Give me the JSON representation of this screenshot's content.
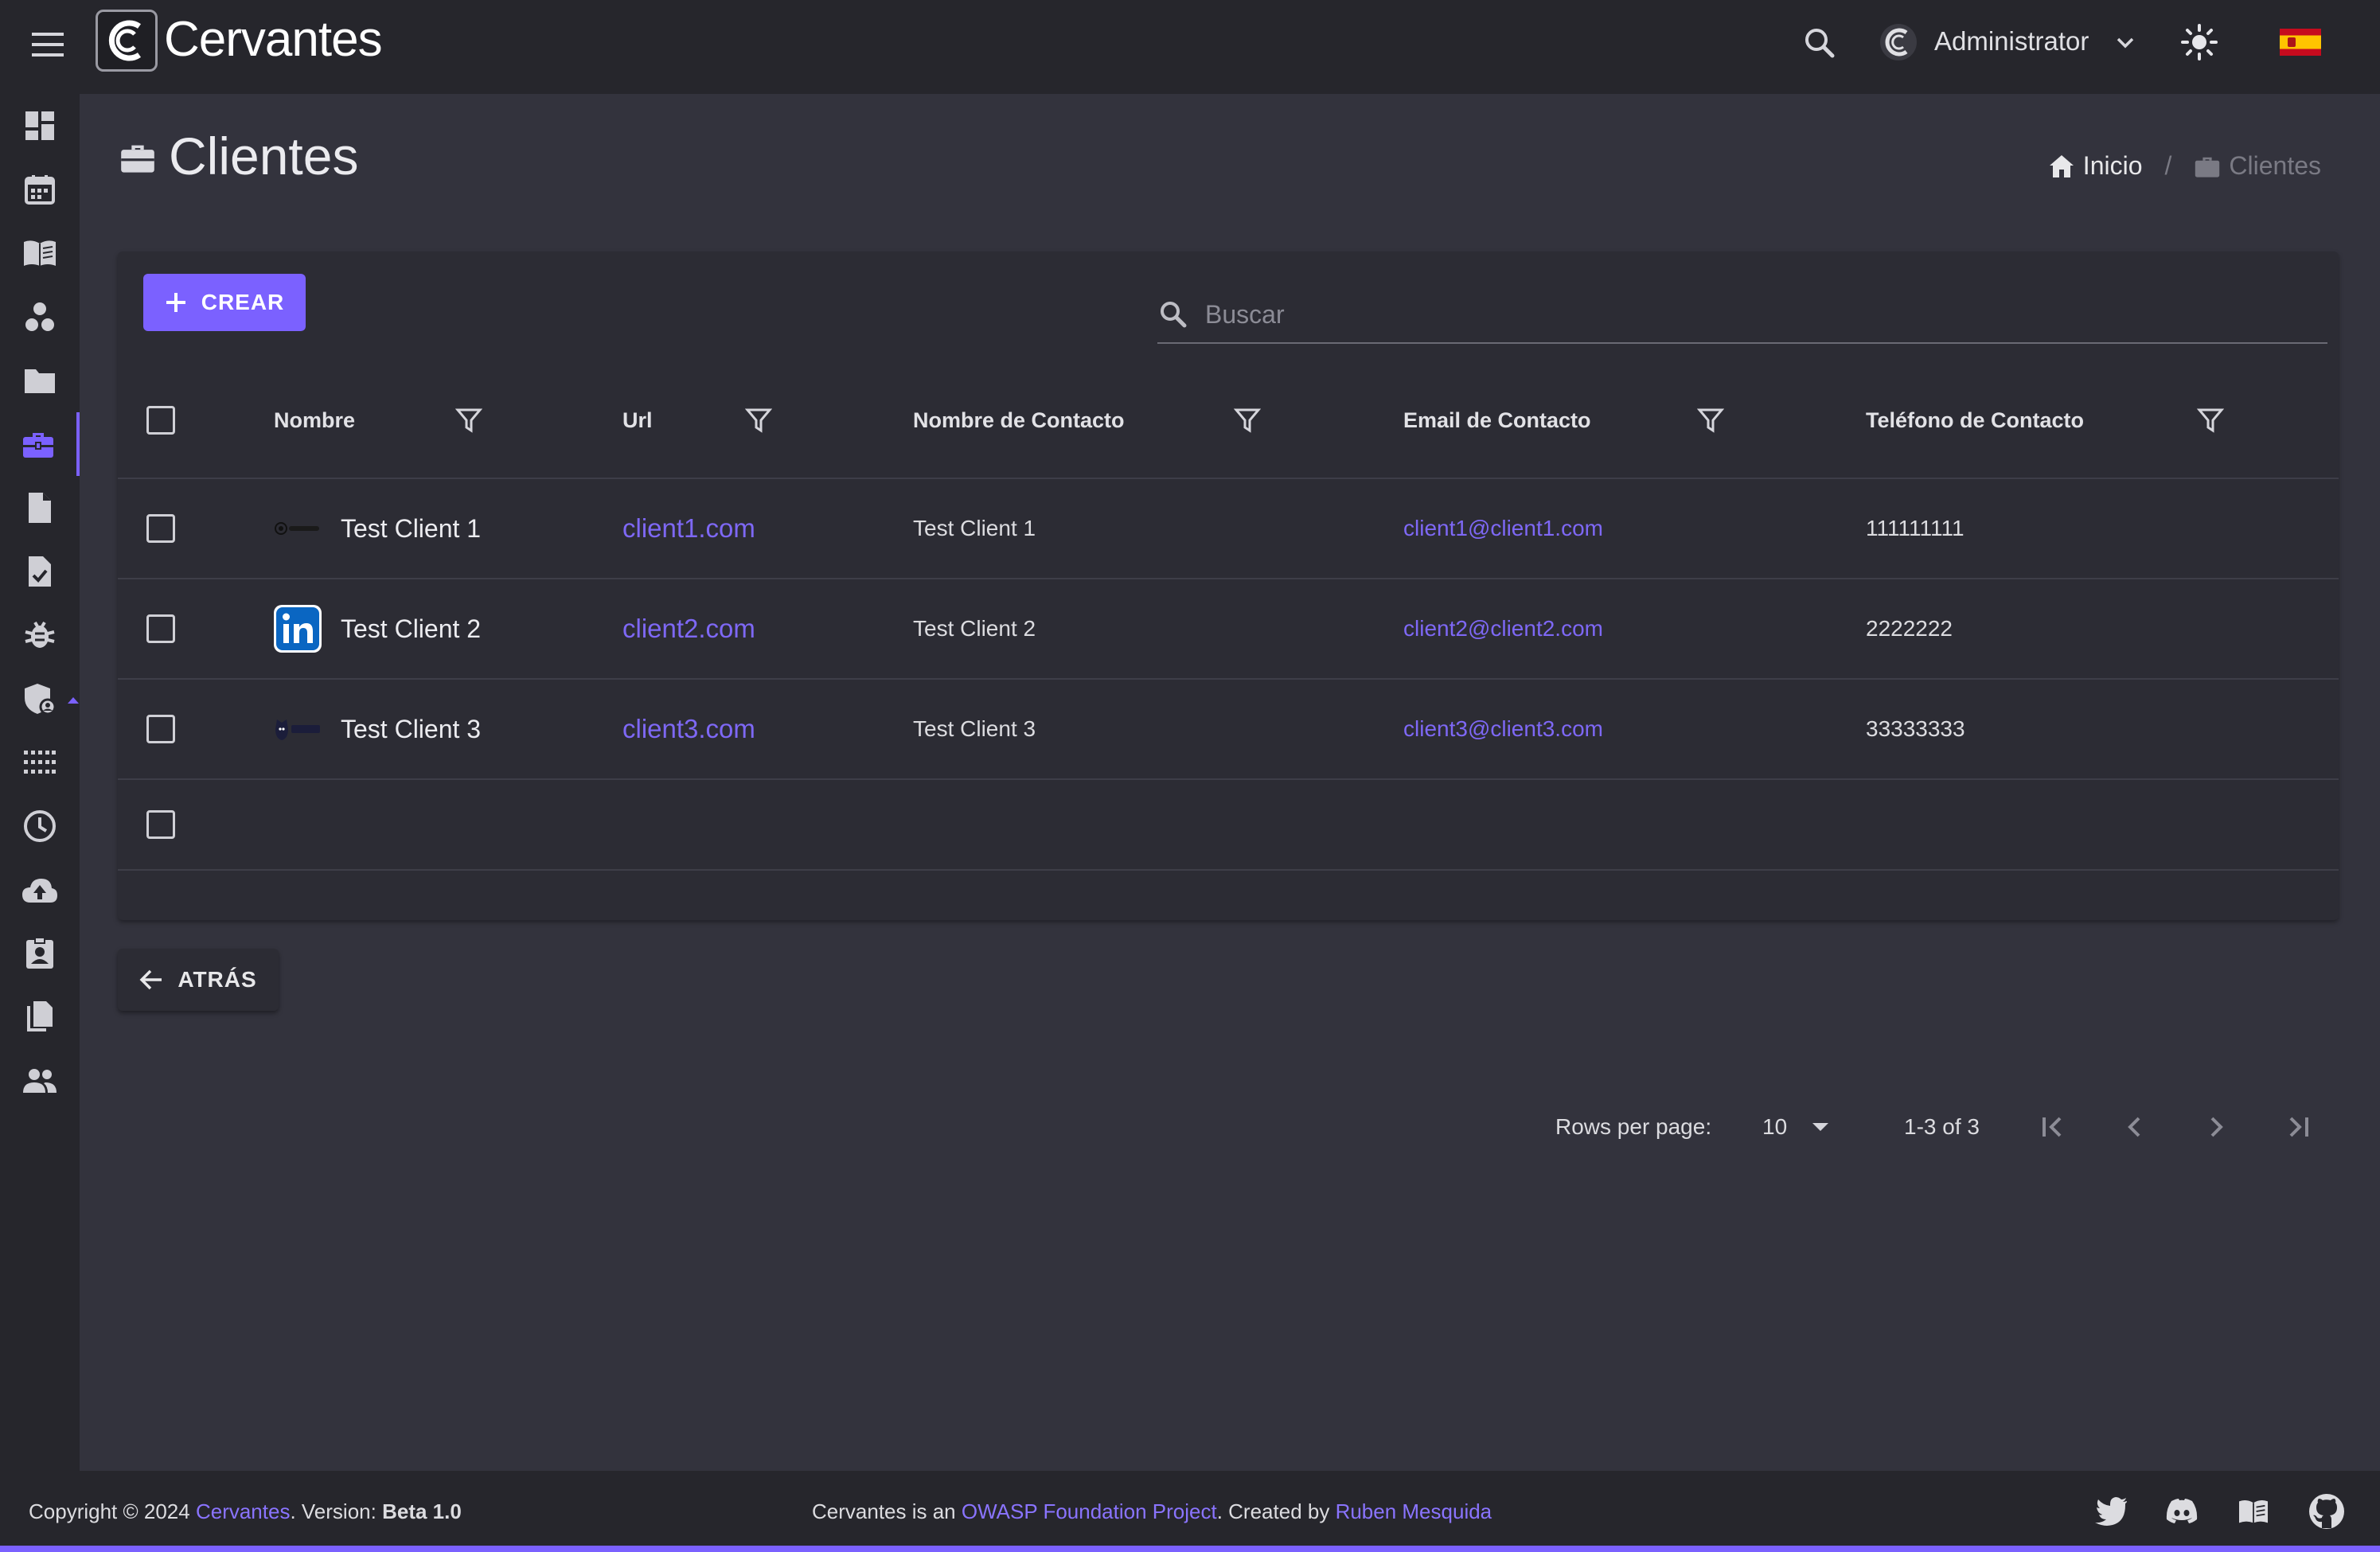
{
  "app": {
    "brand": "Cervantes",
    "user_name": "Administrator"
  },
  "page": {
    "title": "Clientes",
    "breadcrumb": {
      "home": "Inicio",
      "current": "Clientes"
    }
  },
  "toolbar": {
    "create_label": "CREAR",
    "search_placeholder": "Buscar",
    "back_label": "ATRÁS"
  },
  "table": {
    "columns": [
      "Nombre",
      "Url",
      "Nombre de Contacto",
      "Email de Contacto",
      "Teléfono de Contacto"
    ],
    "rows": [
      {
        "name": "Test Client 1",
        "url": "client1.com",
        "contact": "Test Client 1",
        "email": "client1@client1.com",
        "phone": "111111111",
        "logo": "qualys-logo"
      },
      {
        "name": "Test Client 2",
        "url": "client2.com",
        "contact": "Test Client 2",
        "email": "client2@client2.com",
        "phone": "2222222",
        "logo": "linkedin-logo"
      },
      {
        "name": "Test Client 3",
        "url": "client3.com",
        "contact": "Test Client 3",
        "email": "client3@client3.com",
        "phone": "33333333",
        "logo": "snyk-logo"
      }
    ]
  },
  "pagination": {
    "rows_per_page_label": "Rows per page:",
    "rows_per_page": "10",
    "range": "1-3 of 3"
  },
  "footer": {
    "copyright_prefix": "Copyright © 2024 ",
    "brand_link": "Cervantes",
    "version_prefix": ". Version: ",
    "version": "Beta 1.0",
    "owasp_prefix": "Cervantes is an ",
    "owasp_link": "OWASP Foundation Project",
    "created_prefix": ". Created by ",
    "author_link": "Ruben Mesquida"
  },
  "theme": {
    "accent": "#7b61ff",
    "background": "#33333d",
    "surface": "#2c2c34",
    "bar": "#26262c"
  },
  "sidebar_icons": [
    "dashboard-icon",
    "calendar-icon",
    "book-icon",
    "workspaces-icon",
    "folder-icon",
    "briefcase-icon",
    "document-icon",
    "task-icon",
    "bug-icon",
    "shield-user-icon",
    "apps-icon",
    "clock-icon",
    "cloud-upload-icon",
    "contact-badge-icon",
    "copy-icon",
    "users-icon"
  ]
}
